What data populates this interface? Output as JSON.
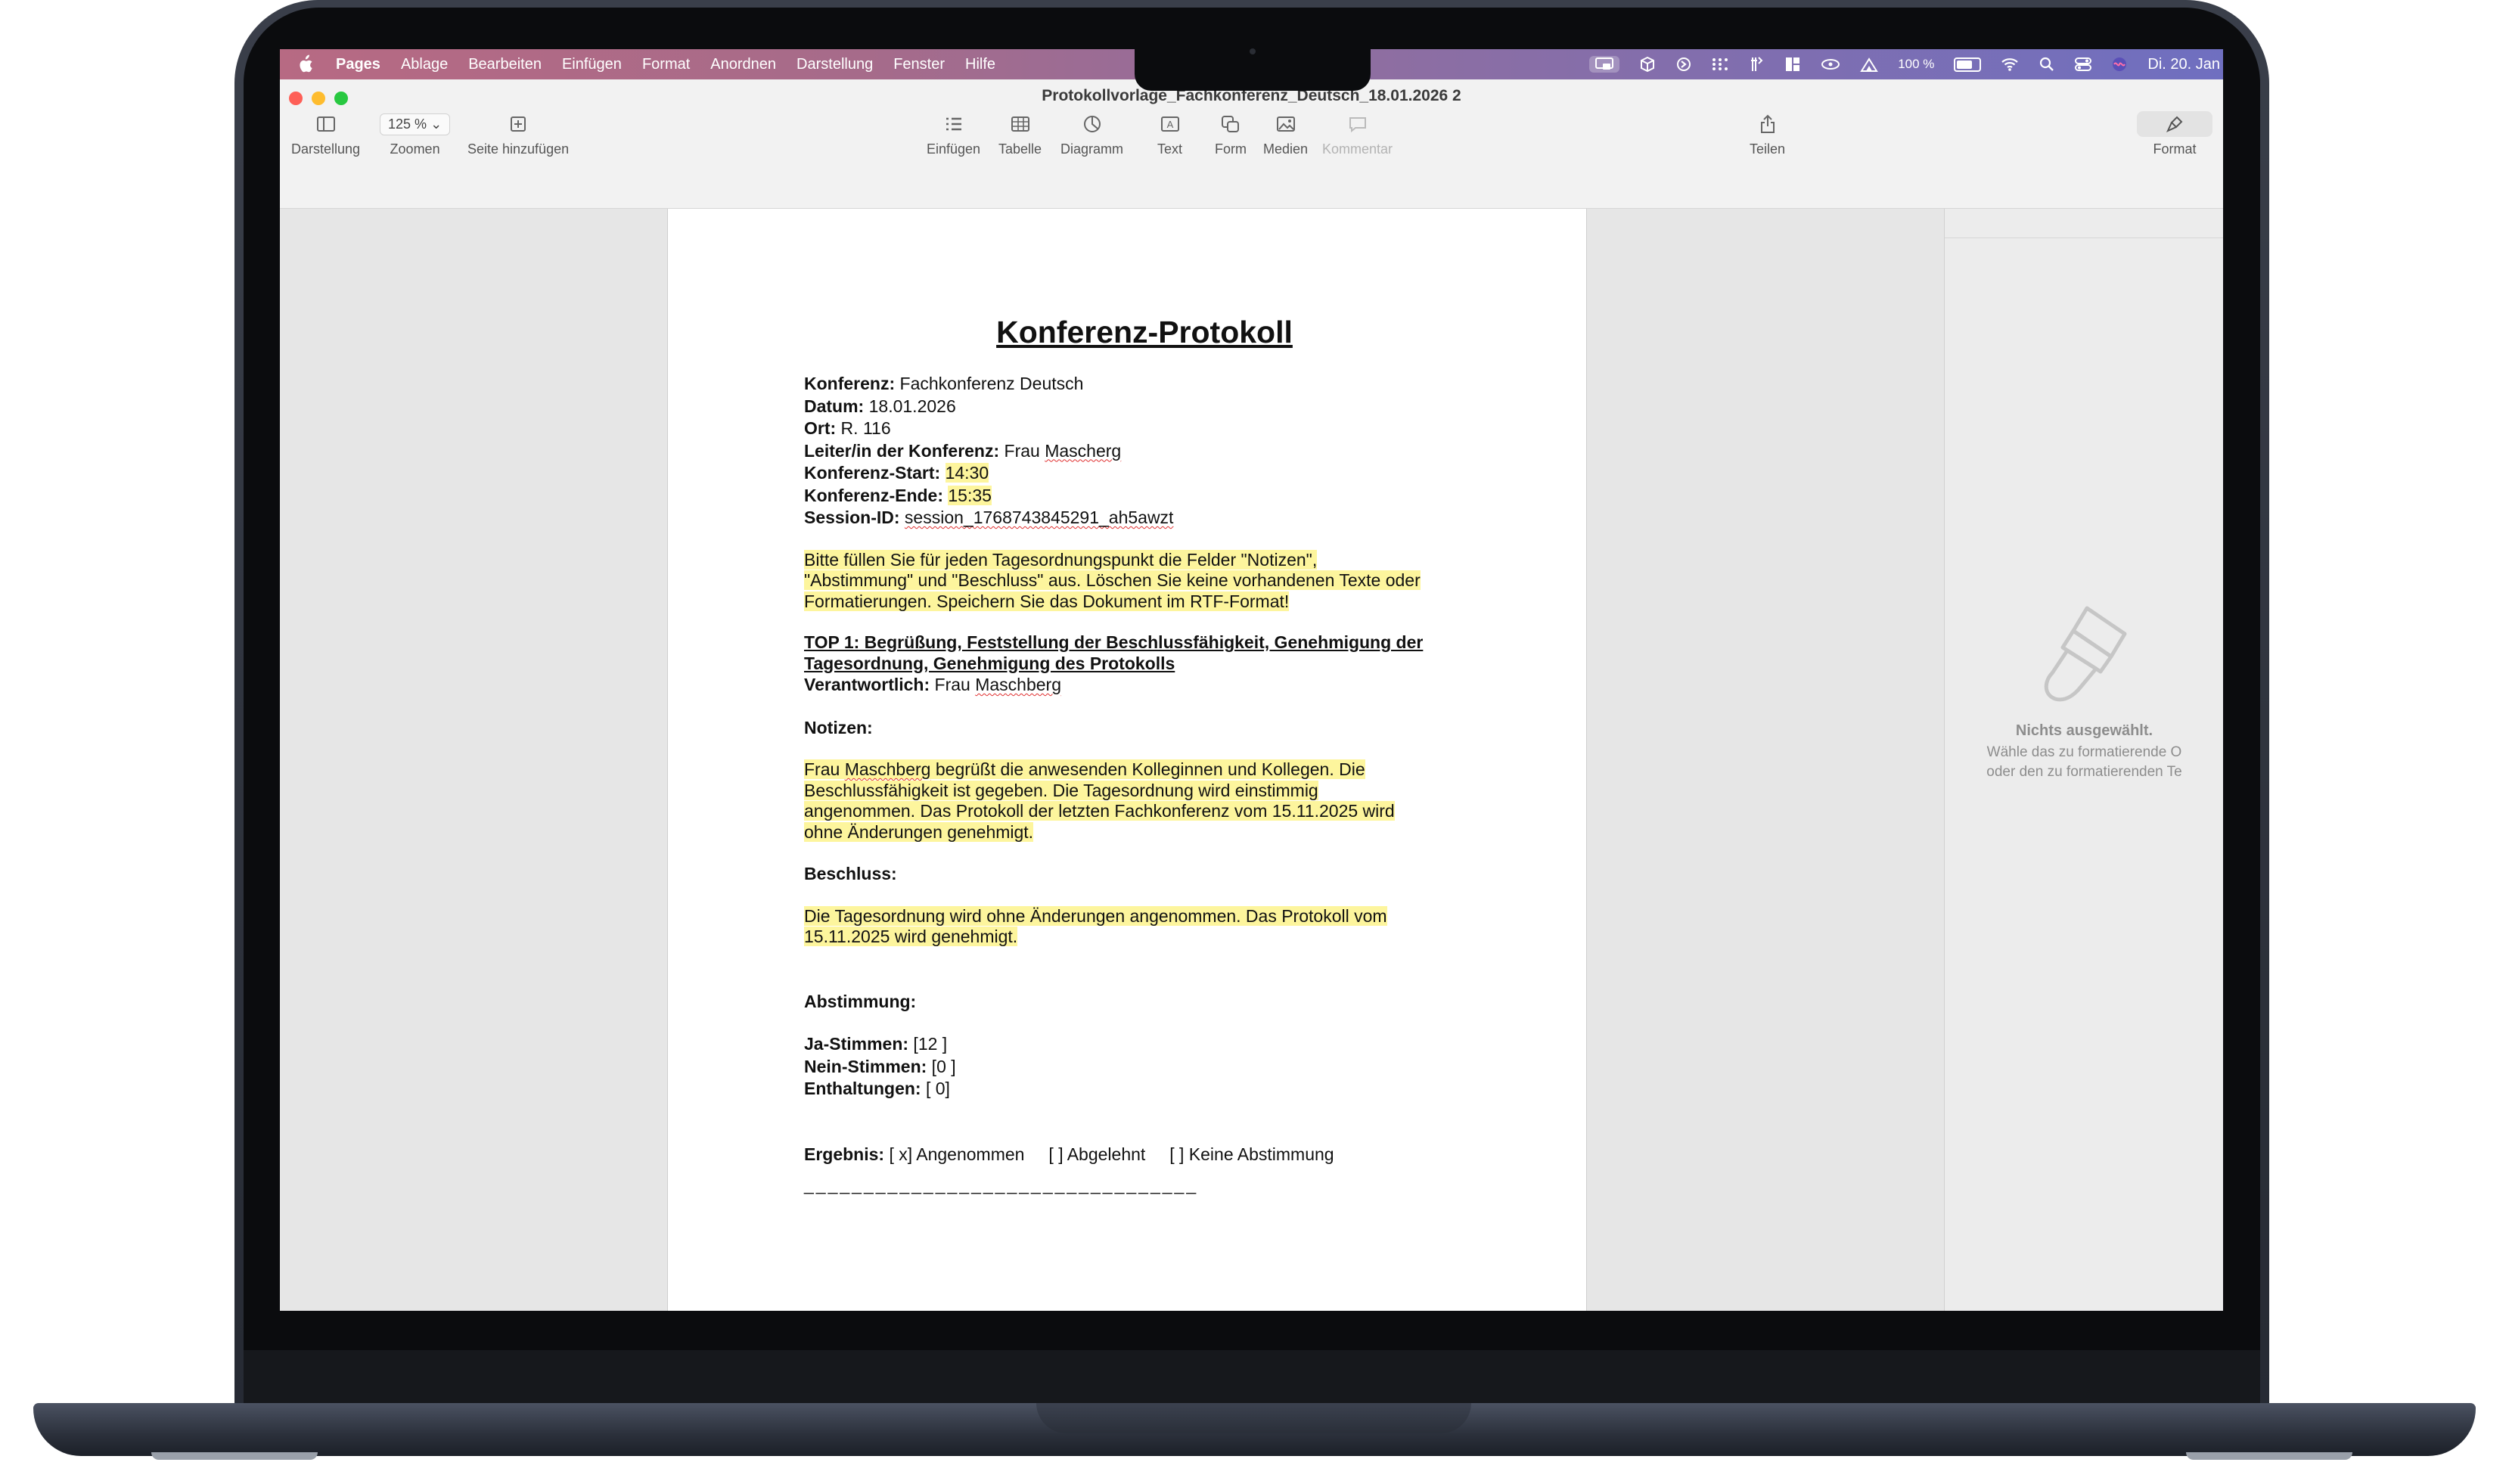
{
  "menubar": {
    "app_name": "Pages",
    "items": [
      "Ablage",
      "Bearbeiten",
      "Einfügen",
      "Format",
      "Anordnen",
      "Darstellung",
      "Fenster",
      "Hilfe"
    ],
    "battery": "100 %",
    "datetime": "Di. 20. Jan"
  },
  "window": {
    "title": "Protokollvorlage_Fachkonferenz_Deutsch_18.01.2026 2"
  },
  "toolbar": {
    "darstellung": "Darstellung",
    "zoom_value": "125 %",
    "zoomen": "Zoomen",
    "seite_hinzufuegen": "Seite hinzufügen",
    "einfuegen": "Einfügen",
    "tabelle": "Tabelle",
    "diagramm": "Diagramm",
    "text": "Text",
    "form": "Form",
    "medien": "Medien",
    "kommentar": "Kommentar",
    "teilen": "Teilen",
    "format": "Format"
  },
  "inspector": {
    "nothing_selected": "Nichts ausgewählt.",
    "hint_line1": "Wähle das zu formatierende O",
    "hint_line2": "oder den zu formatierenden Te"
  },
  "document": {
    "title": "Konferenz-Protokoll",
    "konferenz_label": "Konferenz:",
    "konferenz_value": " Fachkonferenz Deutsch",
    "datum_label": "Datum:",
    "datum_value": " 18.01.2026",
    "ort_label": "Ort:",
    "ort_value": " R. 116",
    "leiter_label": "Leiter/in der Konferenz:",
    "leiter_value_pre": " Frau ",
    "leiter_value_name": "Mascherg",
    "start_label": "Konferenz-Start:",
    "start_value": "14:30",
    "ende_label": "Konferenz-Ende:",
    "ende_value": "15:35",
    "session_label": "Session-ID:",
    "session_value": "session_1768743845291_ah5awzt",
    "instruction_1": "Bitte füllen Sie für jeden Tagesordnungspunkt die Felder \"Notizen\",",
    "instruction_2": "\"Abstimmung\" und \"Beschluss\" aus. Löschen Sie keine vorhandenen Texte oder",
    "instruction_3": "Formatierungen. Speichern Sie das Dokument im RTF-Format!",
    "top1_line1": "TOP 1: Begrüßung, Feststellung der Beschlussfähigkeit, Genehmigung der",
    "top1_line2": "Tagesordnung, Genehmigung des Protokolls",
    "verantwortlich_label": "Verantwortlich:",
    "verantwortlich_pre": " Frau ",
    "verantwortlich_name": "Maschberg",
    "notizen_label": "Notizen:",
    "notizen_1_pre": "Frau ",
    "notizen_1_name": "Maschberg",
    "notizen_1_post": " begrüßt die anwesenden Kolleginnen und Kollegen. Die",
    "notizen_2": "Beschlussfähigkeit ist gegeben. Die Tagesordnung wird einstimmig",
    "notizen_3": "angenommen. Das Protokoll der letzten Fachkonferenz vom 15.11.2025 wird",
    "notizen_4": "ohne Änderungen genehmigt.",
    "beschluss_label": "Beschluss:",
    "beschluss_1": "Die Tagesordnung wird ohne Änderungen angenommen. Das Protokoll vom",
    "beschluss_2": "15.11.2025 wird genehmigt.",
    "abstimmung_label": "Abstimmung:",
    "ja_label": "Ja-Stimmen:",
    "ja_value": " [12 ]",
    "nein_label": "Nein-Stimmen:",
    "nein_value": " [0 ]",
    "enth_label": "Enthaltungen:",
    "enth_value": " [ 0]",
    "ergebnis_label": "Ergebnis:",
    "ergebnis_value": " [ x] Angenommen     [ ] Abgelehnt     [ ] Keine Abstimmung",
    "separator": "_________________________________"
  },
  "colors": {
    "highlight": "#fdf59d",
    "menubar_start": "#b76a83",
    "menubar_end": "#6f6fc0"
  }
}
